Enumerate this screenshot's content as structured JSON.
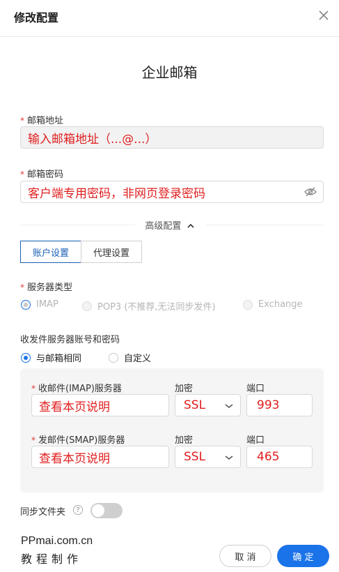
{
  "dialog": {
    "title": "修改配置"
  },
  "heading": "企业邮箱",
  "email": {
    "label": "邮箱地址",
    "value": "输入邮箱地址（...@...）",
    "required_mark": "*"
  },
  "password": {
    "label": "邮箱密码",
    "value": "客户端专用密码，非网页登录密码",
    "required_mark": "*"
  },
  "advanced": {
    "label": "高级配置",
    "chevron": "^"
  },
  "tabs": [
    {
      "label": "账户设置",
      "active": true
    },
    {
      "label": "代理设置",
      "active": false
    }
  ],
  "server_type": {
    "label": "服务器类型",
    "required_mark": "*",
    "options": [
      {
        "label": "IMAP",
        "checked": true
      },
      {
        "label": "POP3 (不推荐,无法同步发件)",
        "checked": false
      },
      {
        "label": "Exchange",
        "checked": false
      }
    ]
  },
  "account": {
    "label": "收发件服务器账号和密码",
    "options": [
      {
        "label": "与邮箱相同",
        "checked": true
      },
      {
        "label": "自定义",
        "checked": false
      }
    ]
  },
  "incoming": {
    "label": "收邮件(IMAP)服务器",
    "required_mark": "*",
    "server": "查看本页说明",
    "encrypt_label": "加密",
    "encrypt": "SSL",
    "port_label": "端口",
    "port": "993"
  },
  "outgoing": {
    "label": "发邮件(SMAP)服务器",
    "required_mark": "*",
    "server": "查看本页说明",
    "encrypt_label": "加密",
    "encrypt": "SSL",
    "port_label": "端口",
    "port": "465"
  },
  "sync": {
    "label": "同步文件夹",
    "help": "?",
    "enabled": false
  },
  "watermark": {
    "line1": "PPmai.com.cn",
    "line2": "教程制作"
  },
  "buttons": {
    "cancel": "取 消",
    "ok": "确 定"
  },
  "colors": {
    "accent": "#1a73e8",
    "annotation_red": "#e01e1e",
    "required": "#e53935"
  },
  "icons": {
    "close": "close-icon",
    "eye_off": "eye-off-icon",
    "chevron_down": "chevron-down-icon",
    "chevron_up": "chevron-up-icon",
    "help": "help-circle-icon"
  }
}
